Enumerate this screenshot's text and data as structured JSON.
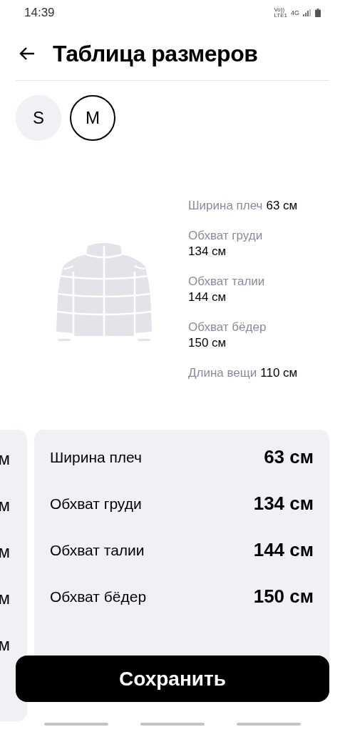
{
  "status_bar": {
    "time": "14:39",
    "indicators": [
      "Vo))",
      "LTE1",
      "4G"
    ]
  },
  "header": {
    "title": "Таблица размеров"
  },
  "sizes": [
    {
      "label": "S",
      "selected": false
    },
    {
      "label": "M",
      "selected": true
    }
  ],
  "diagram": {
    "measurements": [
      {
        "label": "Ширина плеч",
        "value": "63 см",
        "inline": true
      },
      {
        "label": "Обхват груди",
        "value": "134 см",
        "inline": false
      },
      {
        "label": "Обхват талии",
        "value": "144 см",
        "inline": false
      },
      {
        "label": "Обхват бёдер",
        "value": "150 см",
        "inline": false
      },
      {
        "label": "Длина вещи",
        "value": "110 см",
        "inline": true
      }
    ]
  },
  "previous_card": {
    "values": [
      "м",
      "м",
      "м",
      "м",
      "м"
    ]
  },
  "current_card": {
    "rows": [
      {
        "label": "Ширина плеч",
        "value": "63 см"
      },
      {
        "label": "Обхват груди",
        "value": "134 см"
      },
      {
        "label": "Обхват талии",
        "value": "144 см"
      },
      {
        "label": "Обхват бёдер",
        "value": "150 см"
      }
    ]
  },
  "save_button": {
    "label": "Сохранить"
  }
}
